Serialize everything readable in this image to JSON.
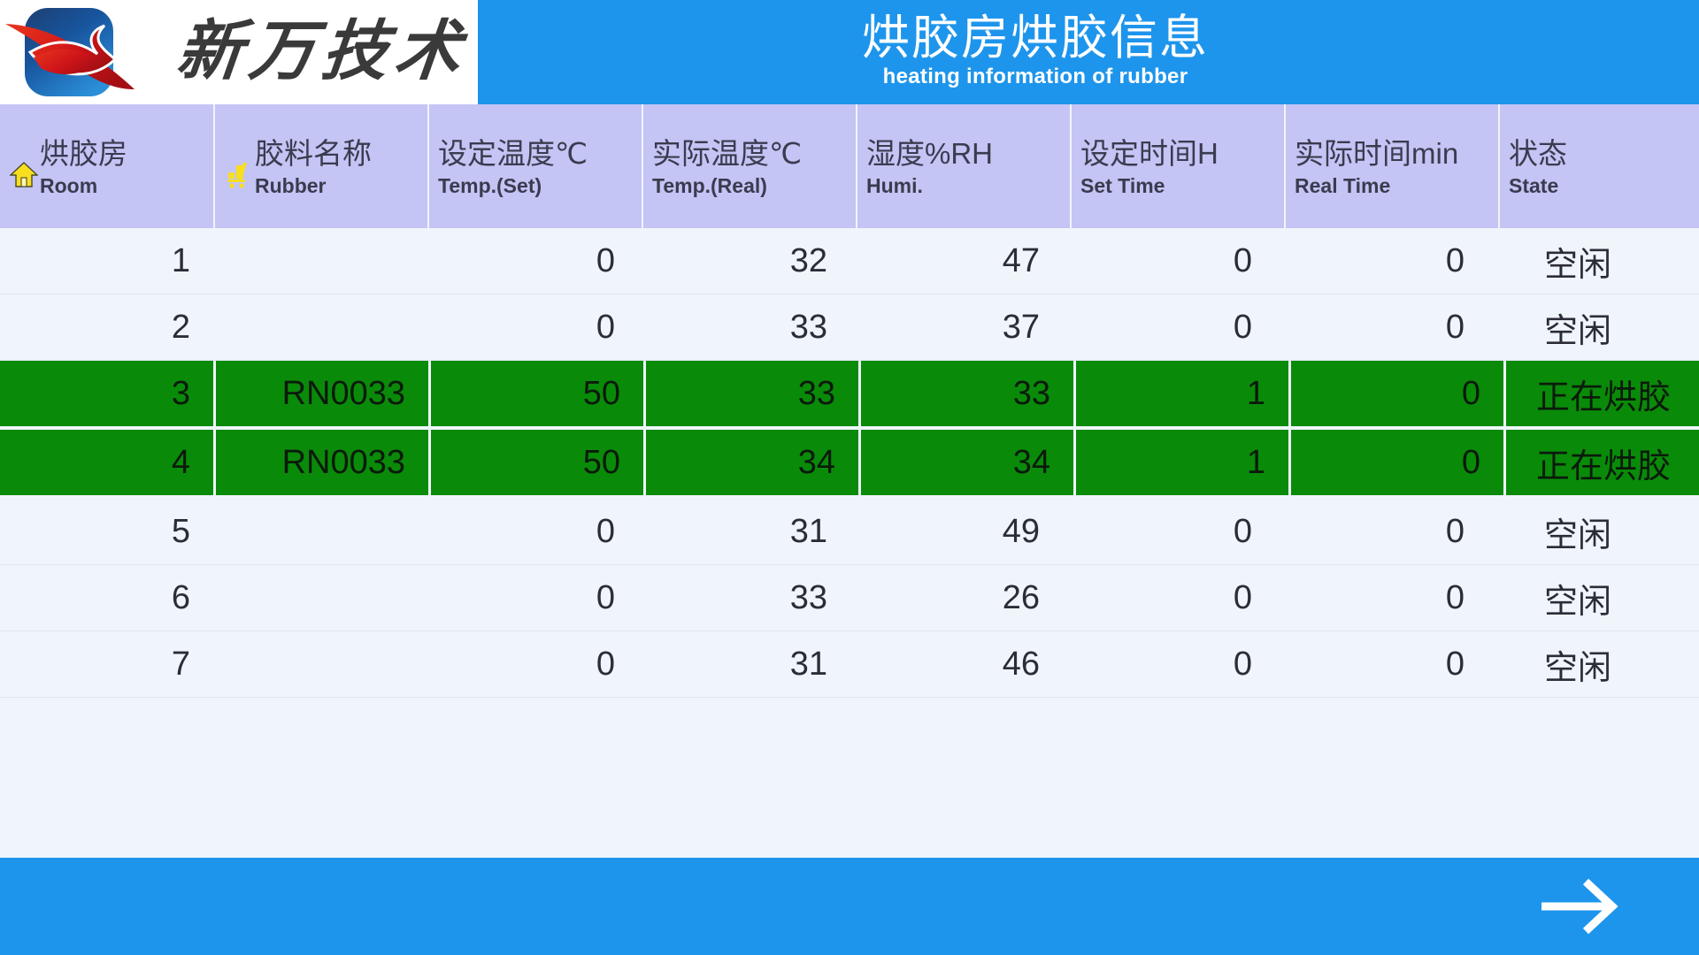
{
  "header": {
    "logo": {
      "mark_icon": "company-logo-mark",
      "brand_text": "新万技术"
    },
    "title_cn": "烘胶房烘胶信息",
    "title_en": "heating information of rubber"
  },
  "table": {
    "columns": [
      {
        "cn": "烘胶房",
        "en": "Room",
        "icon": "home-icon"
      },
      {
        "cn": "胶料名称",
        "en": "Rubber",
        "icon": "cart-icon"
      },
      {
        "cn": "设定温度℃",
        "en": "Temp.(Set)",
        "icon": ""
      },
      {
        "cn": "实际温度℃",
        "en": "Temp.(Real)",
        "icon": ""
      },
      {
        "cn": "湿度%RH",
        "en": "Humi.",
        "icon": ""
      },
      {
        "cn": "设定时间H",
        "en": "Set Time",
        "icon": ""
      },
      {
        "cn": "实际时间min",
        "en": "Real Time",
        "icon": ""
      },
      {
        "cn": "状态",
        "en": "State",
        "icon": ""
      }
    ],
    "rows": [
      {
        "room": "1",
        "rubber": "",
        "temp_set": "0",
        "temp_real": "32",
        "humi": "47",
        "time_set": "0",
        "time_real": "0",
        "state": "空闲",
        "active": false
      },
      {
        "room": "2",
        "rubber": "",
        "temp_set": "0",
        "temp_real": "33",
        "humi": "37",
        "time_set": "0",
        "time_real": "0",
        "state": "空闲",
        "active": false
      },
      {
        "room": "3",
        "rubber": "RN0033",
        "temp_set": "50",
        "temp_real": "33",
        "humi": "33",
        "time_set": "1",
        "time_real": "0",
        "state": "正在烘胶",
        "active": true
      },
      {
        "room": "4",
        "rubber": "RN0033",
        "temp_set": "50",
        "temp_real": "34",
        "humi": "34",
        "time_set": "1",
        "time_real": "0",
        "state": "正在烘胶",
        "active": true
      },
      {
        "room": "5",
        "rubber": "",
        "temp_set": "0",
        "temp_real": "31",
        "humi": "49",
        "time_set": "0",
        "time_real": "0",
        "state": "空闲",
        "active": false
      },
      {
        "room": "6",
        "rubber": "",
        "temp_set": "0",
        "temp_real": "33",
        "humi": "26",
        "time_set": "0",
        "time_real": "0",
        "state": "空闲",
        "active": false
      },
      {
        "room": "7",
        "rubber": "",
        "temp_set": "0",
        "temp_real": "31",
        "humi": "46",
        "time_set": "0",
        "time_real": "0",
        "state": "空闲",
        "active": false
      }
    ]
  },
  "footer": {
    "next_icon": "arrow-right-icon"
  },
  "colors": {
    "brand_blue": "#1E95EC",
    "header_cell": "#C4C4F5",
    "row_bg": "#EFF5FB",
    "active_green": "#0A8A09",
    "icon_yellow": "#F7DF1E"
  }
}
